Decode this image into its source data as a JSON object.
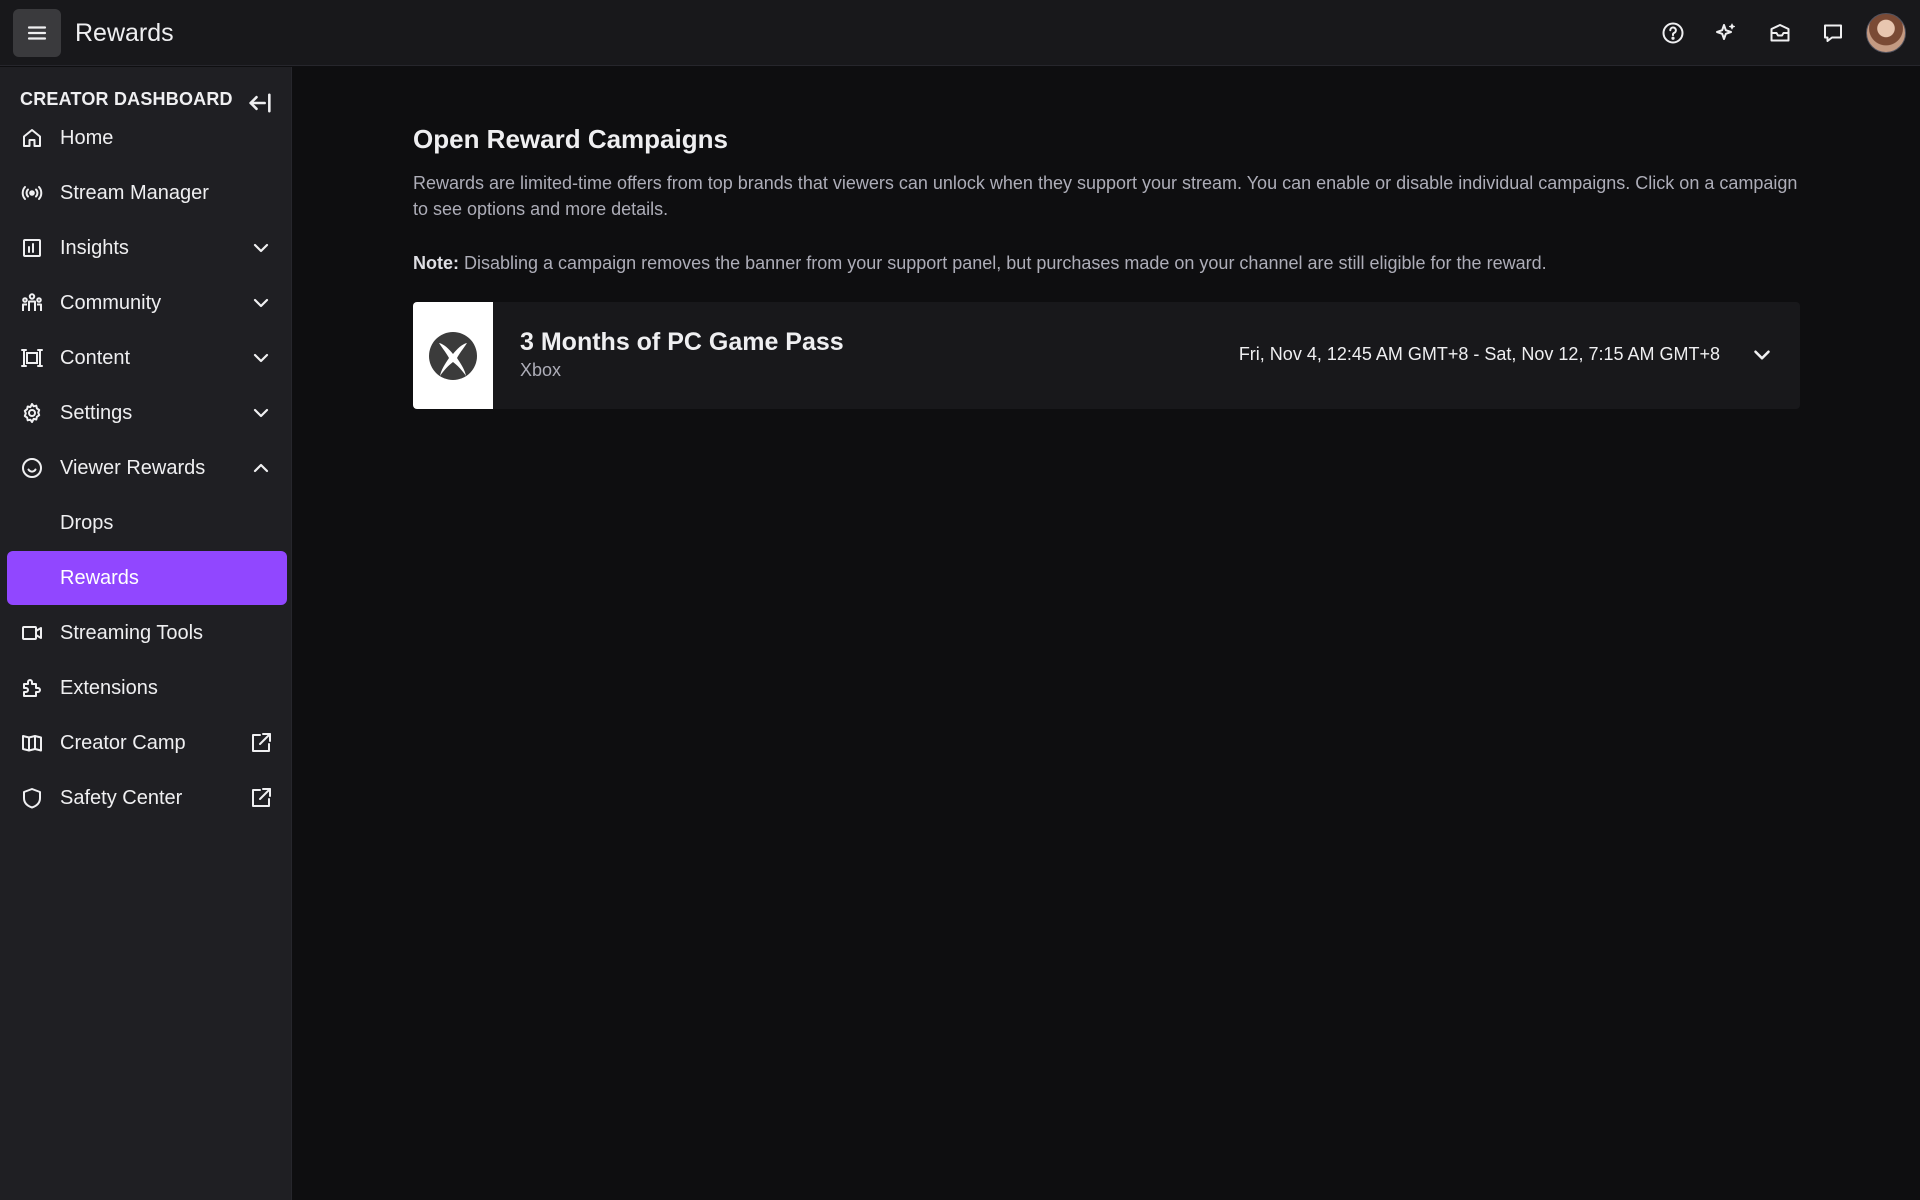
{
  "topbar": {
    "title": "Rewards",
    "icons": [
      "help-icon",
      "sparkle-icon",
      "inbox-icon",
      "whispers-icon"
    ]
  },
  "sidebar": {
    "header": "CREATOR DASHBOARD",
    "items": [
      {
        "label": "Home",
        "icon": "home-icon",
        "chevron": "none"
      },
      {
        "label": "Stream Manager",
        "icon": "stream-icon",
        "chevron": "none"
      },
      {
        "label": "Insights",
        "icon": "insights-icon",
        "chevron": "down"
      },
      {
        "label": "Community",
        "icon": "community-icon",
        "chevron": "down"
      },
      {
        "label": "Content",
        "icon": "content-icon",
        "chevron": "down"
      },
      {
        "label": "Settings",
        "icon": "gear-icon",
        "chevron": "down"
      },
      {
        "label": "Viewer Rewards",
        "icon": "smile-icon",
        "chevron": "up"
      },
      {
        "label": "Drops",
        "icon": "",
        "chevron": "none"
      },
      {
        "label": "Rewards",
        "icon": "",
        "chevron": "none",
        "active": true
      },
      {
        "label": "Streaming Tools",
        "icon": "camera-icon",
        "chevron": "none"
      },
      {
        "label": "Extensions",
        "icon": "puzzle-icon",
        "chevron": "none"
      },
      {
        "label": "Creator Camp",
        "icon": "book-icon",
        "chevron": "external"
      },
      {
        "label": "Safety Center",
        "icon": "shield-icon",
        "chevron": "external"
      }
    ],
    "accent_color": "#9147ff"
  },
  "main": {
    "title": "Open Reward Campaigns",
    "description": "Rewards are limited-time offers from top brands that viewers can unlock when they support your stream. You can enable or disable individual campaigns. Click on a campaign to see options and more details.",
    "note_label": "Note:",
    "note_text": " Disabling a campaign removes the banner from your support panel, but purchases made on your channel are still eligible for the reward.",
    "campaigns": [
      {
        "title": "3 Months of PC Game Pass",
        "brand": "Xbox",
        "dates": "Fri, Nov 4, 12:45 AM GMT+8 - Sat, Nov 12, 7:15 AM GMT+8",
        "logo_icon": "xbox-logo-icon"
      }
    ]
  }
}
